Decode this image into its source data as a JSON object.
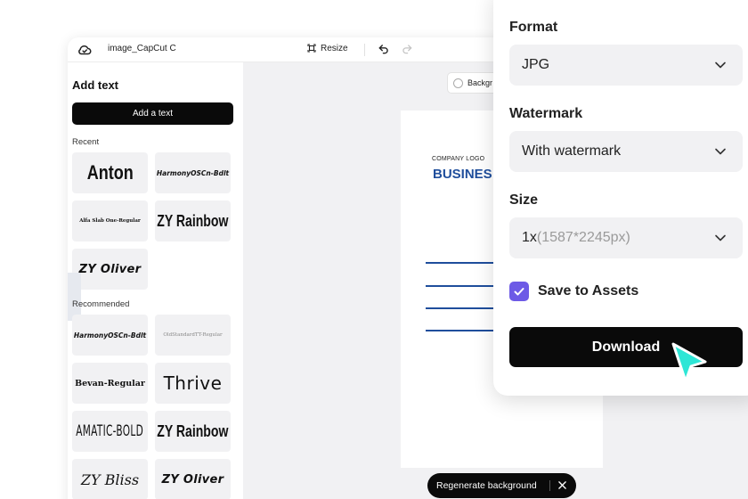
{
  "topbar": {
    "project_name": "image_CapCut C",
    "resize_label": "Resize"
  },
  "text_panel": {
    "title": "Add text",
    "add_button": "Add a text",
    "recent_label": "Recent",
    "recommended_label": "Recommended",
    "recent_fonts": [
      "Anton",
      "HarmonyOSCn-Bdlt",
      "Alfa Slab One-Regular",
      "ZY Rainbow",
      "ZY Oliver"
    ],
    "recommended_fonts": [
      "HarmonyOSCn-Bdlt",
      "OldStandardTT-Regular",
      "Bevan-Regular",
      "Thrive",
      "AMATIC-BOLD",
      "ZY Rainbow",
      "ZY Bliss",
      "ZY Oliver"
    ]
  },
  "canvas": {
    "background_button": "Backgr",
    "page": {
      "logo_text": "COMPANY LOGO",
      "headline": "BUSINES"
    },
    "regenerate_label": "Regenerate background"
  },
  "export_panel": {
    "format_label": "Format",
    "format_value": "JPG",
    "watermark_label": "Watermark",
    "watermark_value": "With watermark",
    "size_label": "Size",
    "size_value": "1x",
    "size_detail": "(1587*2245px)",
    "save_to_assets_label": "Save to Assets",
    "save_to_assets_checked": true,
    "download_label": "Download"
  },
  "colors": {
    "accent_purple": "#6d5ae6",
    "brand_blue": "#1f4e9c",
    "cursor_teal": "#2ee6d6"
  }
}
